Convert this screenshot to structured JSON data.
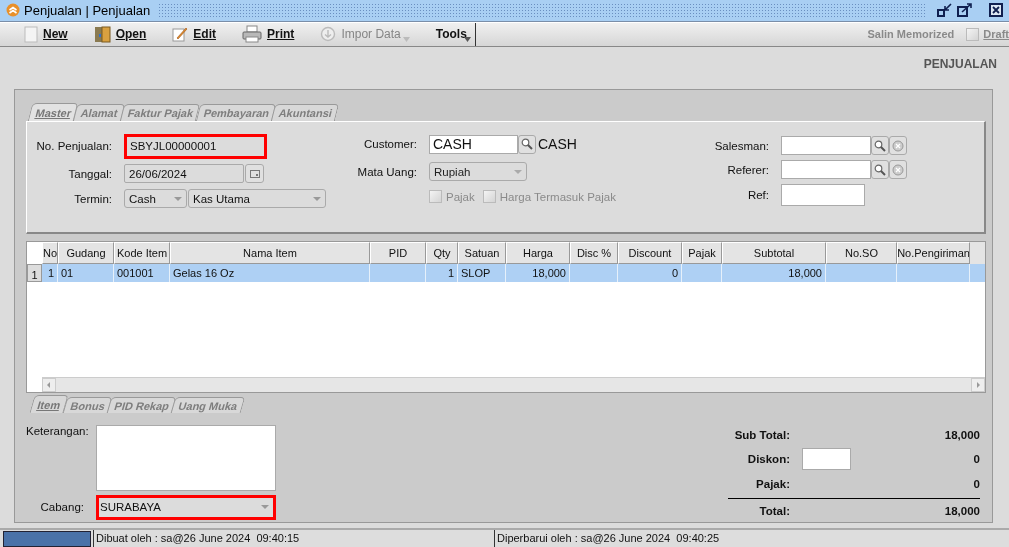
{
  "window": {
    "title": "Penjualan | Penjualan"
  },
  "toolbar": {
    "items": [
      {
        "label": "New",
        "kind": "new",
        "disabled": false
      },
      {
        "label": "Open",
        "kind": "open",
        "disabled": false
      },
      {
        "label": "Edit",
        "kind": "edit",
        "disabled": false
      },
      {
        "label": "Print",
        "kind": "print",
        "disabled": false
      },
      {
        "label": "Impor Data",
        "kind": "import",
        "disabled": true
      },
      {
        "label": "Tools",
        "kind": "tools",
        "disabled": false
      }
    ],
    "right": [
      {
        "label": "Salin Memorized",
        "kind": "button",
        "disabled": true
      },
      {
        "label": "Draft",
        "kind": "checkbox",
        "checked": false,
        "disabled": true
      }
    ]
  },
  "heading": "PENJUALAN",
  "tabs": [
    {
      "label": "Master",
      "selected": true
    },
    {
      "label": "Alamat",
      "selected": false
    },
    {
      "label": "Faktur Pajak",
      "selected": false
    },
    {
      "label": "Pembayaran",
      "selected": false
    },
    {
      "label": "Akuntansi",
      "selected": false
    }
  ],
  "master": {
    "no_penjualan": {
      "label": "No. Penjualan:",
      "value": "SBYJL00000001",
      "highlighted": true
    },
    "tanggal": {
      "label": "Tanggal:",
      "value": "26/06/2024"
    },
    "termin": {
      "label": "Termin:",
      "value": "Cash",
      "account": "Kas Utama"
    },
    "customer": {
      "label": "Customer:",
      "value": "CASH",
      "name": "CASH"
    },
    "mata_uang": {
      "label": "Mata Uang:",
      "value": "Rupiah",
      "disabled": true
    },
    "options": [
      {
        "label": "Pajak",
        "checked": false,
        "disabled": true
      },
      {
        "label": "Harga Termasuk Pajak",
        "checked": false,
        "disabled": true
      }
    ],
    "salesman": {
      "label": "Salesman:"
    },
    "referer": {
      "label": "Referer:"
    },
    "ref": {
      "label": "Ref:"
    }
  },
  "table": {
    "columns": [
      "No",
      "Gudang",
      "Kode Item",
      "Nama Item",
      "PID",
      "Qty",
      "Satuan",
      "Harga",
      "Disc %",
      "Discount",
      "Pajak",
      "Subtotal",
      "No.SO",
      "No.Pengiriman"
    ],
    "rows": [
      {
        "number": "1",
        "selected": true,
        "cells": [
          "1",
          "01",
          "001001",
          "Gelas 16 Oz",
          "",
          "1",
          "SLOP",
          "18,000",
          "",
          "0",
          "",
          "18,000",
          "",
          ""
        ]
      }
    ]
  },
  "bottom_tabs": [
    {
      "label": "Item",
      "selected": true
    },
    {
      "label": "Bonus",
      "selected": false
    },
    {
      "label": "PID Rekap",
      "selected": false
    },
    {
      "label": "Uang Muka",
      "selected": false
    }
  ],
  "keterangan": {
    "label": "Keterangan:"
  },
  "cabang": {
    "label": "Cabang:",
    "value": "SURABAYA",
    "highlighted": true
  },
  "totals": [
    {
      "label": "Sub Total:",
      "value": "18,000",
      "kind": "text"
    },
    {
      "label": "Diskon:",
      "value": "0",
      "kind": "input"
    },
    {
      "label": "Pajak:",
      "value": "0",
      "kind": "text"
    },
    {
      "label": "Total:",
      "value": "18,000",
      "kind": "total"
    }
  ],
  "status_bar": {
    "created": "Dibuat oleh : sa@26 June 2024  09:40:15",
    "updated": "Diperbarui oleh : sa@26 June 2024  09:40:25"
  }
}
